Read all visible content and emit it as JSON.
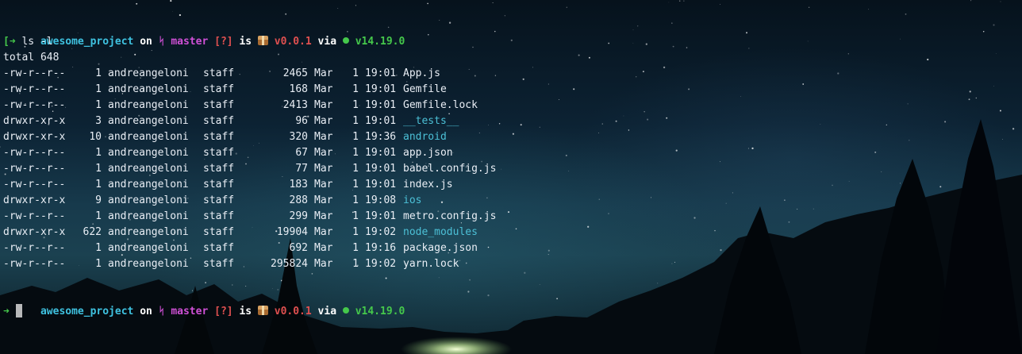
{
  "prompt": {
    "dir": "awesome_project",
    "on": "on",
    "branch_icon": "git-branch-icon",
    "branch": "master",
    "status": "[?]",
    "is": "is",
    "package_icon": "package-icon",
    "version": "v0.0.1",
    "via": "via",
    "node_icon": "node-dot-icon",
    "node_version": "v14.19.0",
    "arrow_icon": "arrow-right-icon"
  },
  "command": "ls -l",
  "total": "total 648",
  "entries": [
    {
      "perm": "-rw-r--r--",
      "links": "1",
      "owner": "andreangeloni",
      "group": "staff",
      "size": "2465",
      "month": "Mar",
      "day": "1",
      "time": "19:01",
      "name": "App.js",
      "is_dir": false
    },
    {
      "perm": "-rw-r--r--",
      "links": "1",
      "owner": "andreangeloni",
      "group": "staff",
      "size": "168",
      "month": "Mar",
      "day": "1",
      "time": "19:01",
      "name": "Gemfile",
      "is_dir": false
    },
    {
      "perm": "-rw-r--r--",
      "links": "1",
      "owner": "andreangeloni",
      "group": "staff",
      "size": "2413",
      "month": "Mar",
      "day": "1",
      "time": "19:01",
      "name": "Gemfile.lock",
      "is_dir": false
    },
    {
      "perm": "drwxr-xr-x",
      "links": "3",
      "owner": "andreangeloni",
      "group": "staff",
      "size": "96",
      "month": "Mar",
      "day": "1",
      "time": "19:01",
      "name": "__tests__",
      "is_dir": true
    },
    {
      "perm": "drwxr-xr-x",
      "links": "10",
      "owner": "andreangeloni",
      "group": "staff",
      "size": "320",
      "month": "Mar",
      "day": "1",
      "time": "19:36",
      "name": "android",
      "is_dir": true
    },
    {
      "perm": "-rw-r--r--",
      "links": "1",
      "owner": "andreangeloni",
      "group": "staff",
      "size": "67",
      "month": "Mar",
      "day": "1",
      "time": "19:01",
      "name": "app.json",
      "is_dir": false
    },
    {
      "perm": "-rw-r--r--",
      "links": "1",
      "owner": "andreangeloni",
      "group": "staff",
      "size": "77",
      "month": "Mar",
      "day": "1",
      "time": "19:01",
      "name": "babel.config.js",
      "is_dir": false
    },
    {
      "perm": "-rw-r--r--",
      "links": "1",
      "owner": "andreangeloni",
      "group": "staff",
      "size": "183",
      "month": "Mar",
      "day": "1",
      "time": "19:01",
      "name": "index.js",
      "is_dir": false
    },
    {
      "perm": "drwxr-xr-x",
      "links": "9",
      "owner": "andreangeloni",
      "group": "staff",
      "size": "288",
      "month": "Mar",
      "day": "1",
      "time": "19:08",
      "name": "ios",
      "is_dir": true
    },
    {
      "perm": "-rw-r--r--",
      "links": "1",
      "owner": "andreangeloni",
      "group": "staff",
      "size": "299",
      "month": "Mar",
      "day": "1",
      "time": "19:01",
      "name": "metro.config.js",
      "is_dir": false
    },
    {
      "perm": "drwxr-xr-x",
      "links": "622",
      "owner": "andreangeloni",
      "group": "staff",
      "size": "19904",
      "month": "Mar",
      "day": "1",
      "time": "19:02",
      "name": "node_modules",
      "is_dir": true
    },
    {
      "perm": "-rw-r--r--",
      "links": "1",
      "owner": "andreangeloni",
      "group": "staff",
      "size": "692",
      "month": "Mar",
      "day": "1",
      "time": "19:16",
      "name": "package.json",
      "is_dir": false
    },
    {
      "perm": "-rw-r--r--",
      "links": "1",
      "owner": "andreangeloni",
      "group": "staff",
      "size": "295824",
      "month": "Mar",
      "day": "1",
      "time": "19:02",
      "name": "yarn.lock",
      "is_dir": false
    }
  ],
  "colors": {
    "dir_name": "#4cc0d6",
    "prompt_dir": "#3fc2e0",
    "branch": "#d050d6",
    "status": "#e05050",
    "node": "#45c84b"
  }
}
